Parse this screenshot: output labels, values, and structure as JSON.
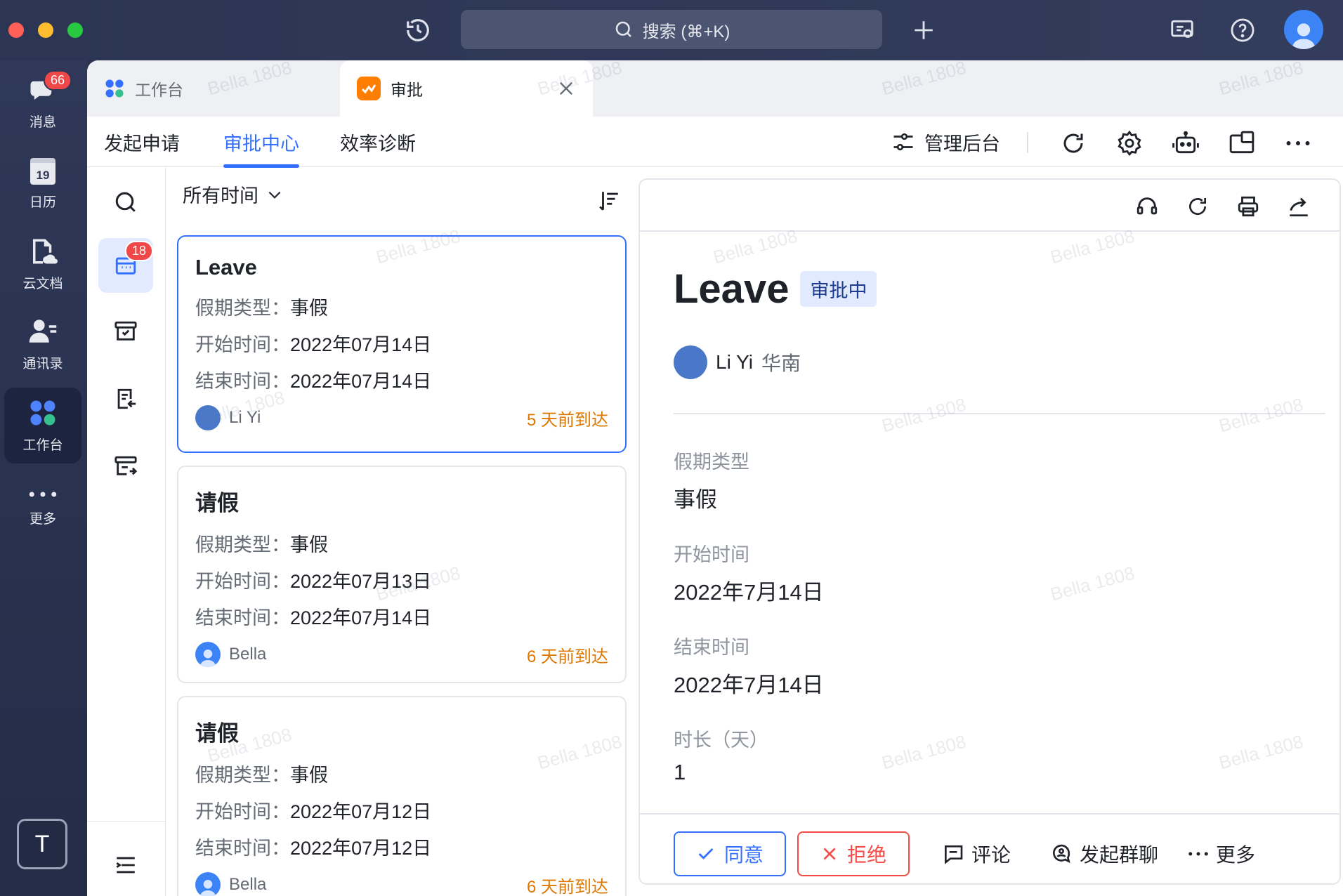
{
  "topbar": {
    "search_placeholder": "搜索 (⌘+K)"
  },
  "leftnav": {
    "messages_label": "消息",
    "messages_badge": "66",
    "calendar_label": "日历",
    "calendar_date": "19",
    "docs_label": "云文档",
    "contacts_label": "通讯录",
    "workspace_label": "工作台",
    "more_label": "更多",
    "user_initial": "T"
  },
  "tabs": [
    {
      "label": "工作台"
    },
    {
      "label": "审批"
    }
  ],
  "subnav": {
    "items": [
      "发起申请",
      "审批中心",
      "效率诊断"
    ],
    "admin_label": "管理后台"
  },
  "rail": {
    "badge": "18"
  },
  "list": {
    "filter_label": "所有时间",
    "cards": [
      {
        "title": "Leave",
        "type_key": "假期类型：",
        "type_val": "事假",
        "start_key": "开始时间：",
        "start_val": "2022年07月14日",
        "end_key": "结束时间：",
        "end_val": "2022年07月14日",
        "user": "Li Yi",
        "arrived": "5 天前到达"
      },
      {
        "title": "请假",
        "type_key": "假期类型：",
        "type_val": "事假",
        "start_key": "开始时间：",
        "start_val": "2022年07月13日",
        "end_key": "结束时间：",
        "end_val": "2022年07月14日",
        "user": "Bella",
        "arrived": "6 天前到达"
      },
      {
        "title": "请假",
        "type_key": "假期类型：",
        "type_val": "事假",
        "start_key": "开始时间：",
        "start_val": "2022年07月12日",
        "end_key": "结束时间：",
        "end_val": "2022年07月12日",
        "user": "Bella",
        "arrived": "6 天前到达"
      }
    ]
  },
  "detail": {
    "title": "Leave",
    "status": "审批中",
    "applicant": "Li Yi",
    "region": "华南",
    "fields": [
      {
        "label": "假期类型",
        "value": "事假"
      },
      {
        "label": "开始时间",
        "value": "2022年7月14日"
      },
      {
        "label": "结束时间",
        "value": "2022年7月14日"
      },
      {
        "label": "时长（天）",
        "value": "1"
      }
    ],
    "actions": {
      "approve": "同意",
      "reject": "拒绝",
      "comment": "评论",
      "group_chat": "发起群聊",
      "more": "更多"
    }
  },
  "watermark": "Bella 1808",
  "colors": {
    "accent": "#3370ff",
    "reject": "#f54a45",
    "arrive": "#de7802",
    "status_bg": "#e1eaff"
  }
}
